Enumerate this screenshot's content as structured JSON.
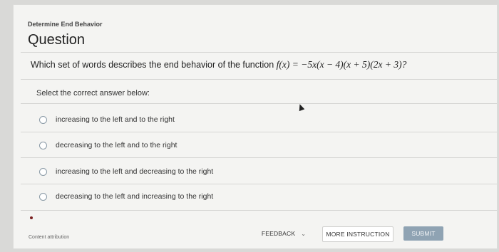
{
  "header": {
    "eyebrow": "Determine End Behavior",
    "title": "Question"
  },
  "question": {
    "text_prefix": "Which set of words describes the end behavior of the function ",
    "formula": "f(x) = −5x(x − 4)(x + 5)(2x + 3)?",
    "prompt": "Select the correct answer below:"
  },
  "options": [
    {
      "label": "increasing to the left and to the right",
      "selected": false
    },
    {
      "label": "decreasing to the left and to the right",
      "selected": false
    },
    {
      "label": "increasing to the left and decreasing to the right",
      "selected": false
    },
    {
      "label": "decreasing to the left and increasing to the right",
      "selected": false
    }
  ],
  "footer": {
    "feedback_label": "FEEDBACK",
    "more_label": "MORE INSTRUCTION",
    "submit_label": "SUBMIT",
    "attribution": "Content attribution"
  },
  "colors": {
    "submit_bg": "#8fa3b3",
    "radio_border": "#8a9aa6"
  }
}
